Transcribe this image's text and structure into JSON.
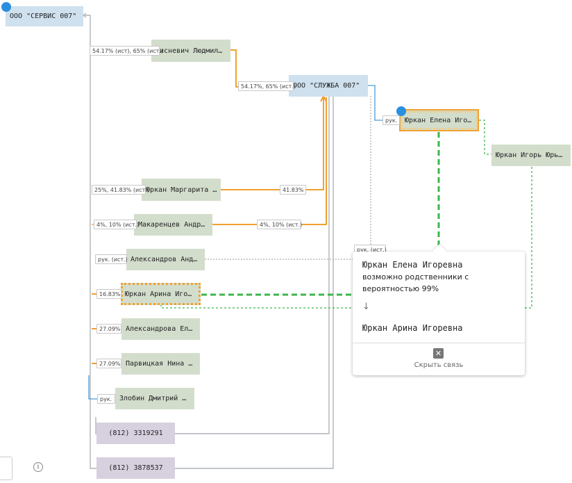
{
  "nodes": {
    "servis": "ООО \"СЕРВИС 007\"",
    "sluzhba": "ООО \"СЛУЖБА 007\"",
    "lisnevich": "Лисневич Людмил…",
    "yurkan_elena": "Юркан Елена Иго…",
    "yurkan_igor": "Юркан Игорь Юрь…",
    "yurkan_margarita": "Юркан Маргарита …",
    "makarentsev": "Макаренцев Андр…",
    "aleksandrov": "Александров Анд…",
    "yurkan_arina": "Юркан Арина Иго…",
    "aleksandrova": "Александрова Ел…",
    "parvitskaya": "Парвицкая Нина …",
    "zlobin": "Злобин Дмитрий …",
    "phone1": "(812) 3319291",
    "phone2": "(812) 3878537"
  },
  "labels": {
    "lisnevich_servis": "54.17% (ист), 65% (ист.)",
    "lisnevich_sluzhba": "54.17%, 65% (ист.)",
    "elena_ruk": "рук.",
    "margarita_left": "25%, 41.83% (ист.)",
    "margarita_right": "41.83%",
    "makarentsev_left": "4%, 10% (ист.)",
    "makarentsev_right": "4%, 10% (ист.)",
    "aleksandrov_ruk": "рук. (ист.)",
    "aleksandrov_ruk_right": "рук. (ист.)",
    "arina_share": "16.83%",
    "aleksandrova_share": "27.09%",
    "parvitskaya_share": "27.09%",
    "zlobin_ruk": "рук."
  },
  "popup": {
    "from_name": "Юркан Елена Игоревна",
    "relation": "возможно родственники с вероятностью 99%",
    "arrow": "↓",
    "to_name": "Юркан Арина Игоревна",
    "close_icon": "✕",
    "hide_link": "Скрыть связь"
  },
  "controls": {
    "info_icon": "i"
  },
  "colors": {
    "company": "#cfe0ee",
    "person": "#d3ddcc",
    "phone": "#d7d0df",
    "share_link": "#f0a030",
    "role_link": "#4a9ad4",
    "kin_link": "#3cb54a",
    "marker": "#2b8fe0"
  }
}
